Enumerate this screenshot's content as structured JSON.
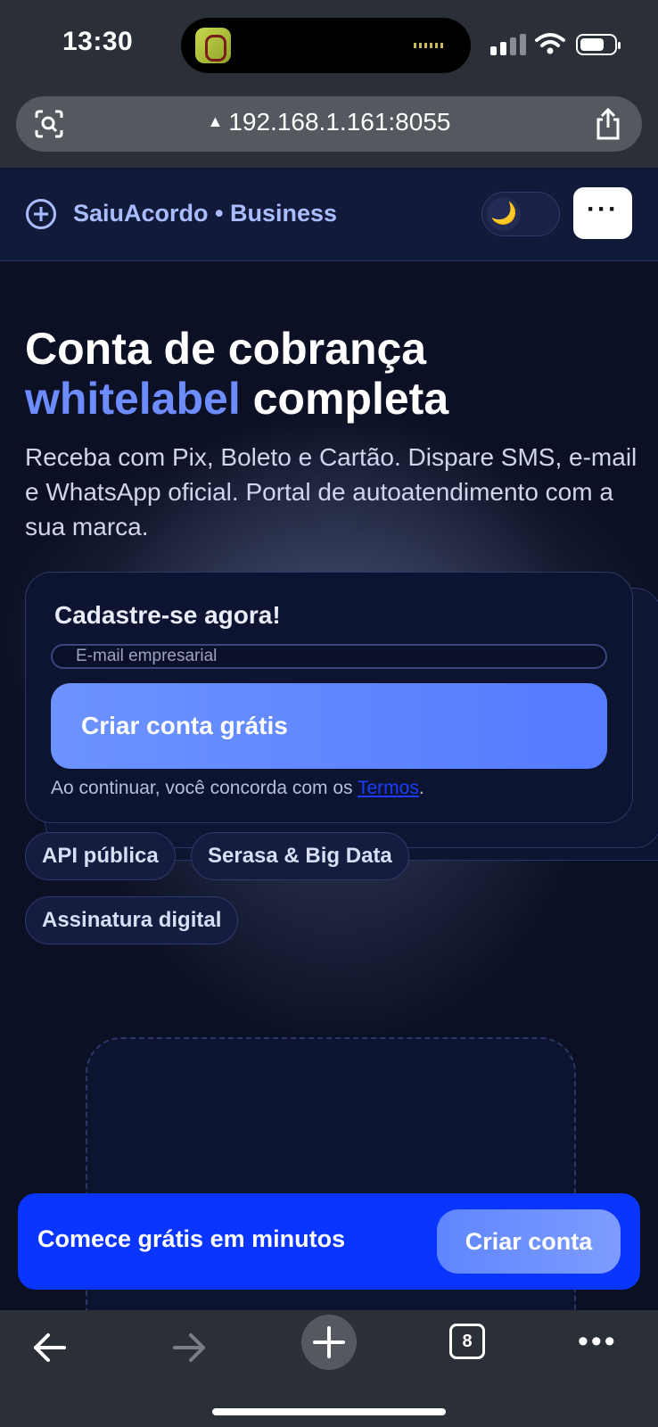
{
  "status_bar": {
    "time": "13:30"
  },
  "browser": {
    "url": "192.168.1.161:8055",
    "tabs_count": "8"
  },
  "header": {
    "brand": "SaiuAcordo • Business"
  },
  "hero": {
    "title_line1": "Conta de cobrança",
    "title_accent": "whitelabel",
    "title_rest": " completa",
    "subtitle": "Receba com Pix, Boleto e Cartão. Dispare SMS, e-mail e WhatsApp oficial. Portal de autoatendimento com a sua marca."
  },
  "signup": {
    "title": "Cadastre-se agora!",
    "email_placeholder": "E-mail empresarial",
    "submit_label": "Criar conta grátis",
    "terms_prefix": "Ao continuar, você concorda com os ",
    "terms_link": "Termos",
    "terms_suffix": "."
  },
  "features": [
    "API pública",
    "Serasa & Big Data",
    "Assinatura digital"
  ],
  "cta_banner": {
    "text": "Comece grátis em minutos",
    "button": "Criar conta"
  },
  "colors": {
    "accent": "#6d8cff",
    "banner": "#0a35ff",
    "background": "#0b1024"
  }
}
